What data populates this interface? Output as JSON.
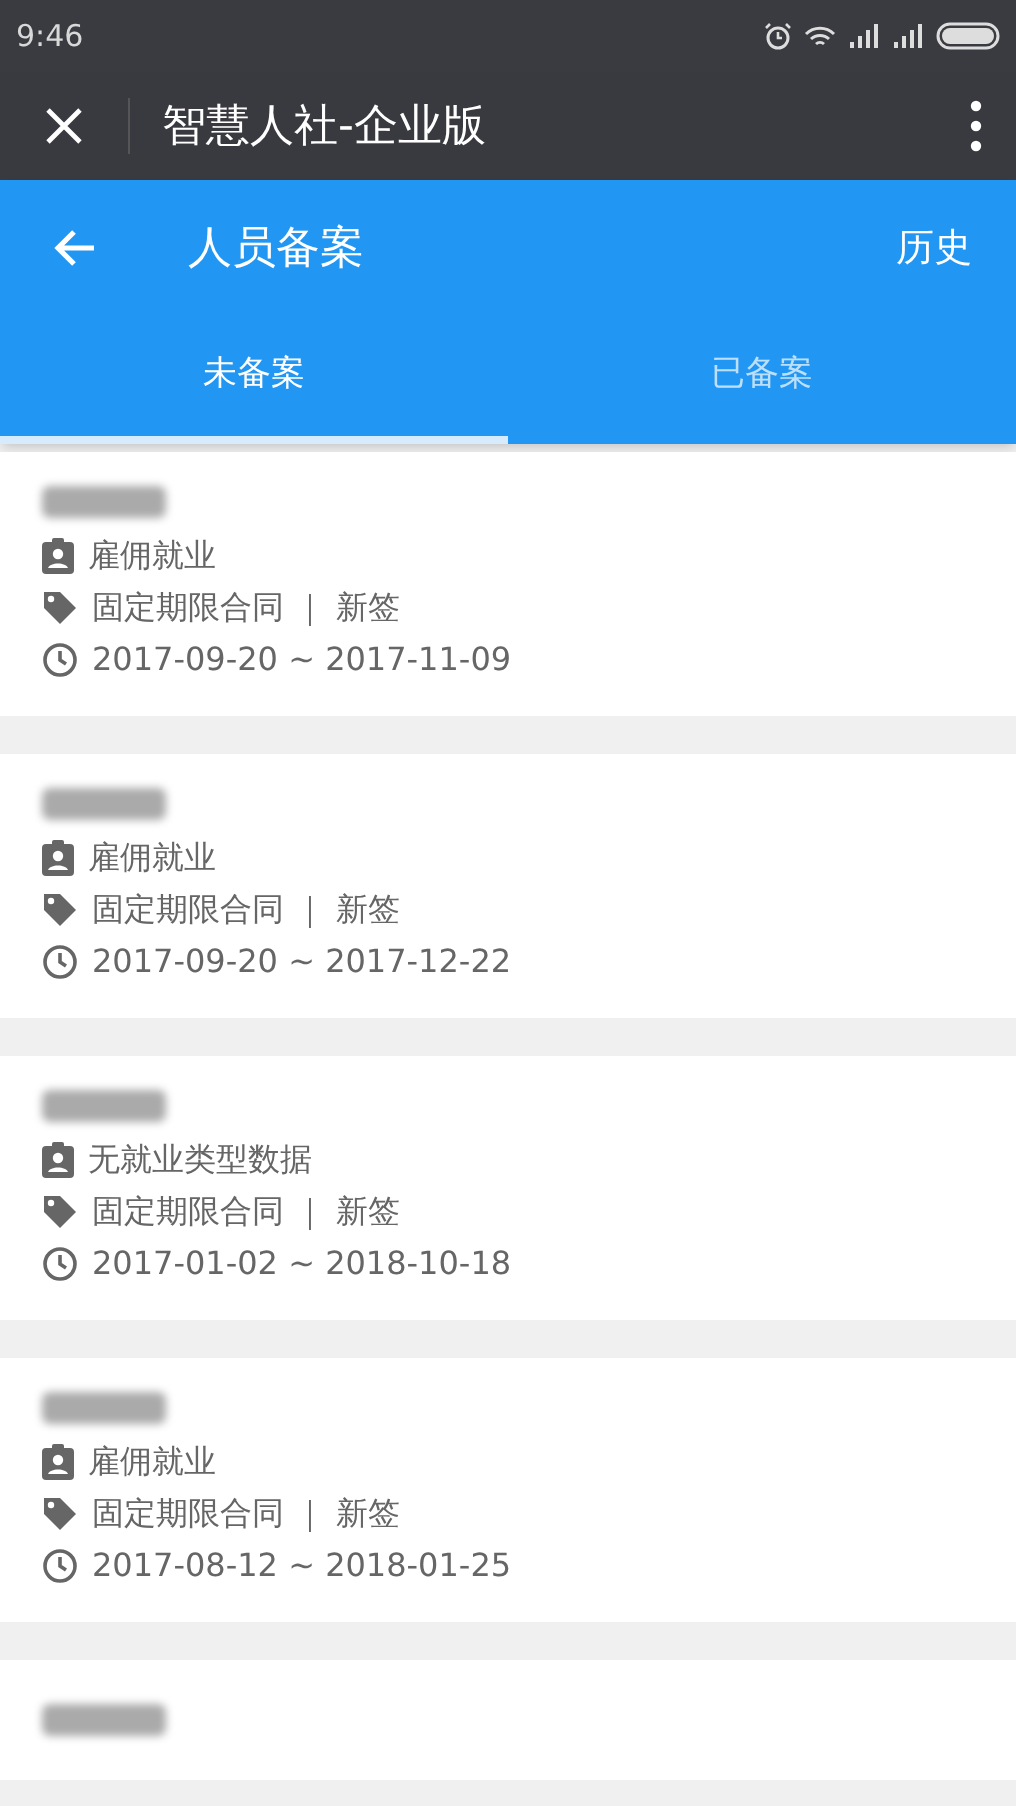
{
  "status_bar": {
    "time": "9:46"
  },
  "title_bar": {
    "title": "智慧人社-企业版"
  },
  "header": {
    "title": "人员备案",
    "action": "历史"
  },
  "tabs": [
    {
      "label": "未备案",
      "selected": true
    },
    {
      "label": "已备案",
      "selected": false
    }
  ],
  "records": [
    {
      "employment": "雇佣就业",
      "contract": "固定期限合同 ｜ 新签",
      "period": "2017-09-20 ~ 2017-11-09"
    },
    {
      "employment": "雇佣就业",
      "contract": "固定期限合同 ｜ 新签",
      "period": "2017-09-20 ~ 2017-12-22"
    },
    {
      "employment": "无就业类型数据",
      "contract": "固定期限合同 ｜ 新签",
      "period": "2017-01-02 ~ 2018-10-18"
    },
    {
      "employment": "雇佣就业",
      "contract": "固定期限合同 ｜ 新签",
      "period": "2017-08-12 ~ 2018-01-25"
    }
  ]
}
